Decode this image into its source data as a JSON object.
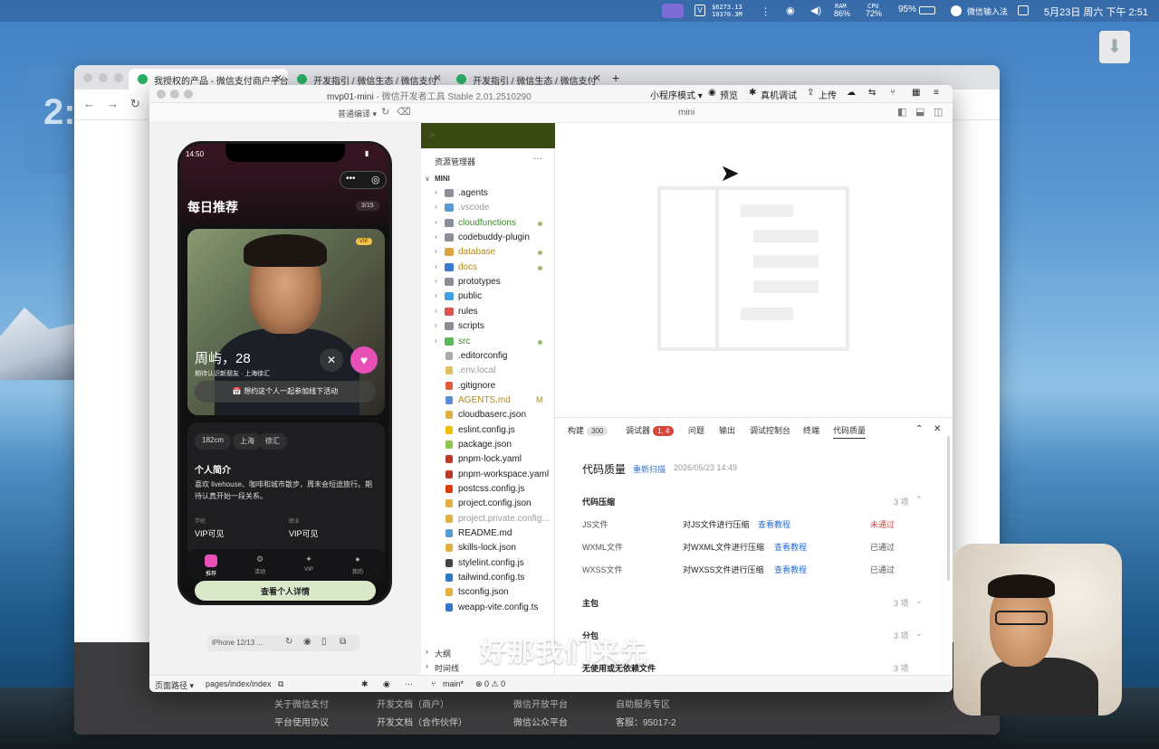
{
  "menubar": {
    "stat_money": "$6273.13",
    "stat_count": "10370.3M",
    "ram_label": "RAM",
    "ram_value": "86%",
    "cpu_label": "CPU",
    "cpu_value": "72%",
    "battery": "95%",
    "input_method": "微信输入法",
    "datetime": "5月23日 周六 下午 2:51"
  },
  "browser": {
    "tabs": [
      {
        "label": "我授权的产品 - 微信支付商户平台"
      },
      {
        "label": "开发指引 / 微信生态 / 微信支付"
      },
      {
        "label": "开发指引 / 微信生态 / 微信支付"
      }
    ],
    "new_tab": "+",
    "footer": {
      "links": [
        "关于微信支付",
        "平台使用协议",
        "开发文档（商户）",
        "开发文档（合作伙伴）",
        "微信开放平台",
        "微信公众平台",
        "自助服务专区",
        "客服：95017-2"
      ]
    }
  },
  "devtools": {
    "title_project": "mvp01-mini",
    "title_app": "微信开发者工具 Stable 2.01.2510290",
    "toolbar": {
      "mode": "小程序模式 ▾",
      "preview": "预览",
      "remote_debug": "真机调试",
      "upload": "上传"
    },
    "compile_mode": "普通编译 ▾",
    "editor_tab": "mini",
    "simulator": {
      "time": "14:50",
      "heading": "每日推荐",
      "counter": "3/15",
      "vip_tag": "VIP",
      "name": "周屿，28",
      "sub": "期待认识新朋友 · 上海徐汇",
      "invite": "📅 想约这个人一起参加线下活动",
      "chips": [
        "182cm",
        "上海",
        "徐汇"
      ],
      "intro_title": "个人简介",
      "intro_text": "喜欢 livehouse、咖啡和城市散步，周末会短途旅行。期待认真开始一段关系。",
      "field1_label": "学校",
      "field1_value": "VIP可见",
      "field2_label": "职业",
      "field2_value": "VIP可见",
      "tabs": [
        "推荐",
        "活动",
        "VIP",
        "我的"
      ],
      "detail_button": "查看个人详情",
      "device": "iPhone 12/13 ..."
    },
    "explorer": {
      "title": "资源管理器",
      "more": "···",
      "root": "MINI",
      "items": [
        {
          "name": ".agents",
          "kind": "folder",
          "color": "#8a8f99",
          "dim": false,
          "marker": ""
        },
        {
          "name": ".vscode",
          "kind": "folder",
          "color": "#5b9bd5",
          "dim": true,
          "marker": ""
        },
        {
          "name": "cloudfunctions",
          "kind": "folder",
          "color": "#8a8f99",
          "dim": false,
          "marker": "dot",
          "text_color": "#3b8a2a"
        },
        {
          "name": "codebuddy-plugin",
          "kind": "folder",
          "color": "#8a8f99",
          "dim": false,
          "marker": ""
        },
        {
          "name": "database",
          "kind": "folder",
          "color": "#d9a441",
          "dim": false,
          "marker": "dot",
          "text_color": "#b08a1e"
        },
        {
          "name": "docs",
          "kind": "folder",
          "color": "#3a7bd5",
          "dim": false,
          "marker": "dot",
          "text_color": "#b08a1e"
        },
        {
          "name": "prototypes",
          "kind": "folder",
          "color": "#8a8f99",
          "dim": false,
          "marker": ""
        },
        {
          "name": "public",
          "kind": "folder",
          "color": "#3fa0e0",
          "dim": false,
          "marker": ""
        },
        {
          "name": "rules",
          "kind": "folder",
          "color": "#d9534f",
          "dim": false,
          "marker": ""
        },
        {
          "name": "scripts",
          "kind": "folder",
          "color": "#8a8f99",
          "dim": false,
          "marker": ""
        },
        {
          "name": "src",
          "kind": "folder",
          "color": "#5cb85c",
          "dim": false,
          "marker": "dot",
          "text_color": "#3b8a2a"
        },
        {
          "name": ".editorconfig",
          "kind": "file",
          "color": "#aaaaaa",
          "dim": false,
          "marker": ""
        },
        {
          "name": ".env.local",
          "kind": "file",
          "color": "#e0c060",
          "dim": true,
          "marker": ""
        },
        {
          "name": ".gitignore",
          "kind": "file",
          "color": "#e05d3a",
          "dim": false,
          "marker": ""
        },
        {
          "name": "AGENTS.md",
          "kind": "file",
          "color": "#5b8bd5",
          "dim": false,
          "marker": "M",
          "text_color": "#b08a1e"
        },
        {
          "name": "cloudbaserc.json",
          "kind": "file",
          "color": "#e0b040",
          "dim": false,
          "marker": ""
        },
        {
          "name": "eslint.config.js",
          "kind": "file",
          "color": "#f0c000",
          "dim": false,
          "marker": ""
        },
        {
          "name": "package.json",
          "kind": "file",
          "color": "#8cc84b",
          "dim": false,
          "marker": ""
        },
        {
          "name": "pnpm-lock.yaml",
          "kind": "file",
          "color": "#c0392b",
          "dim": false,
          "marker": ""
        },
        {
          "name": "pnpm-workspace.yaml",
          "kind": "file",
          "color": "#c0392b",
          "dim": false,
          "marker": ""
        },
        {
          "name": "postcss.config.js",
          "kind": "file",
          "color": "#dd3a0a",
          "dim": false,
          "marker": ""
        },
        {
          "name": "project.config.json",
          "kind": "file",
          "color": "#e0b040",
          "dim": false,
          "marker": ""
        },
        {
          "name": "project.private.config...",
          "kind": "file",
          "color": "#e0b040",
          "dim": true,
          "marker": ""
        },
        {
          "name": "README.md",
          "kind": "file",
          "color": "#5b9bd5",
          "dim": false,
          "marker": ""
        },
        {
          "name": "skills-lock.json",
          "kind": "file",
          "color": "#e0b040",
          "dim": false,
          "marker": ""
        },
        {
          "name": "stylelint.config.js",
          "kind": "file",
          "color": "#444444",
          "dim": false,
          "marker": ""
        },
        {
          "name": "tailwind.config.ts",
          "kind": "file",
          "color": "#3178c6",
          "dim": false,
          "marker": ""
        },
        {
          "name": "tsconfig.json",
          "kind": "file",
          "color": "#e0b040",
          "dim": false,
          "marker": ""
        },
        {
          "name": "weapp-vite.config.ts",
          "kind": "file",
          "color": "#3178c6",
          "dim": false,
          "marker": ""
        }
      ],
      "outline": "大纲",
      "timeline": "时间线"
    },
    "panel": {
      "tabs": [
        {
          "label": "构建",
          "badge": "300",
          "badge_style": "grey"
        },
        {
          "label": "调试器",
          "badge": "1, 4",
          "badge_style": "red"
        },
        {
          "label": "问题",
          "badge": "",
          "badge_style": ""
        },
        {
          "label": "输出",
          "badge": "",
          "badge_style": ""
        },
        {
          "label": "调试控制台",
          "badge": "",
          "badge_style": ""
        },
        {
          "label": "终端",
          "badge": "",
          "badge_style": ""
        },
        {
          "label": "代码质量",
          "badge": "",
          "badge_style": "active"
        }
      ],
      "title": "代码质量",
      "rescan": "重新扫描",
      "timestamp": "2026/05/23 14:49",
      "section1": "代码压缩",
      "section1_count": "3 项",
      "rows": [
        {
          "name": "JS文件",
          "desc": "对JS文件进行压缩",
          "link": "查看教程",
          "status": "未通过",
          "fail": true
        },
        {
          "name": "WXML文件",
          "desc": "对WXML文件进行压缩",
          "link": "查看教程",
          "status": "已通过",
          "fail": false
        },
        {
          "name": "WXSS文件",
          "desc": "对WXSS文件进行压缩",
          "link": "查看教程",
          "status": "已通过",
          "fail": false
        }
      ],
      "section2": "主包",
      "section2_count": "3 项",
      "section3": "分包",
      "section3_count": "3 项",
      "section4": "无使用或无依赖文件",
      "section4_count": "3 项"
    },
    "statusbar": {
      "page_path": "页面路径 ▾",
      "path": "pages/index/index",
      "branch": "main*",
      "errors": "⊗ 0 ⚠ 0"
    }
  },
  "subtitle": "好那我们来先"
}
